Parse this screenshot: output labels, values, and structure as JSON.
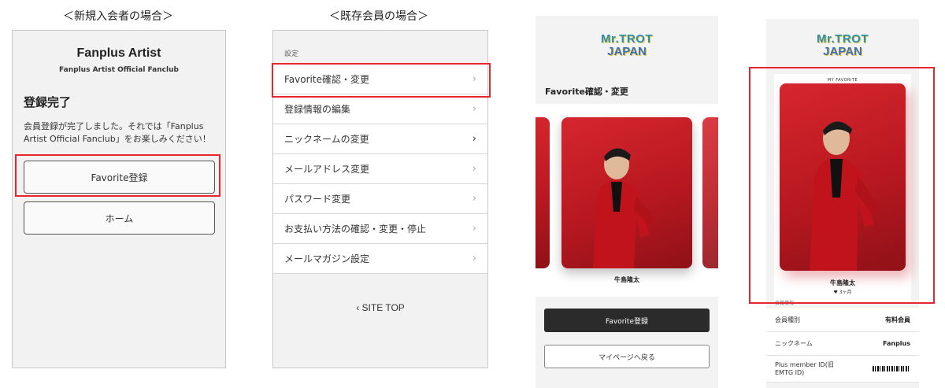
{
  "captions": {
    "new_member": "＜新規入会者の場合＞",
    "existing_member": "＜既存会員の場合＞"
  },
  "panel1": {
    "app_title": "Fanplus Artist",
    "app_subtitle": "Fanplus Artist Official Fanclub",
    "heading": "登録完了",
    "message": "会員登録が完了しました。それでは「Fanplus Artist Official Fanclub」をお楽しみください！",
    "favorite_button": "Favorite登録",
    "home_button": "ホーム"
  },
  "panel2": {
    "section_label": "設定",
    "items": [
      {
        "label": "Favorite確認・変更"
      },
      {
        "label": "登録情報の編集"
      },
      {
        "label": "ニックネームの変更"
      },
      {
        "label": "メールアドレス変更"
      },
      {
        "label": "パスワード変更"
      },
      {
        "label": "お支払い方法の確認・変更・停止"
      },
      {
        "label": "メールマガジン設定"
      }
    ],
    "site_top": "SITE TOP",
    "chevron": "›"
  },
  "logo": {
    "line1": "Mr.TROT",
    "line2": "JAPAN"
  },
  "panel3": {
    "heading": "Favorite確認・変更",
    "artist_name": "牛島隆太",
    "register_button": "Favorite登録",
    "mypage_button": "マイページへ戻る"
  },
  "panel4": {
    "card_tag": "MY FAVORITE",
    "artist_name": "牛島隆太",
    "likes": "♥ 3ヶ月",
    "info_heading": "会員情報",
    "rows": [
      {
        "label": "会員種別",
        "value": "有料会員"
      },
      {
        "label": "ニックネーム",
        "value": "Fanplus"
      },
      {
        "label": "Plus member ID(旧EMTG ID)",
        "value": ""
      }
    ]
  },
  "colors": {
    "highlight": "#e8262d",
    "photo_red": "#c41e26",
    "dark_button": "#2b2b2b"
  }
}
